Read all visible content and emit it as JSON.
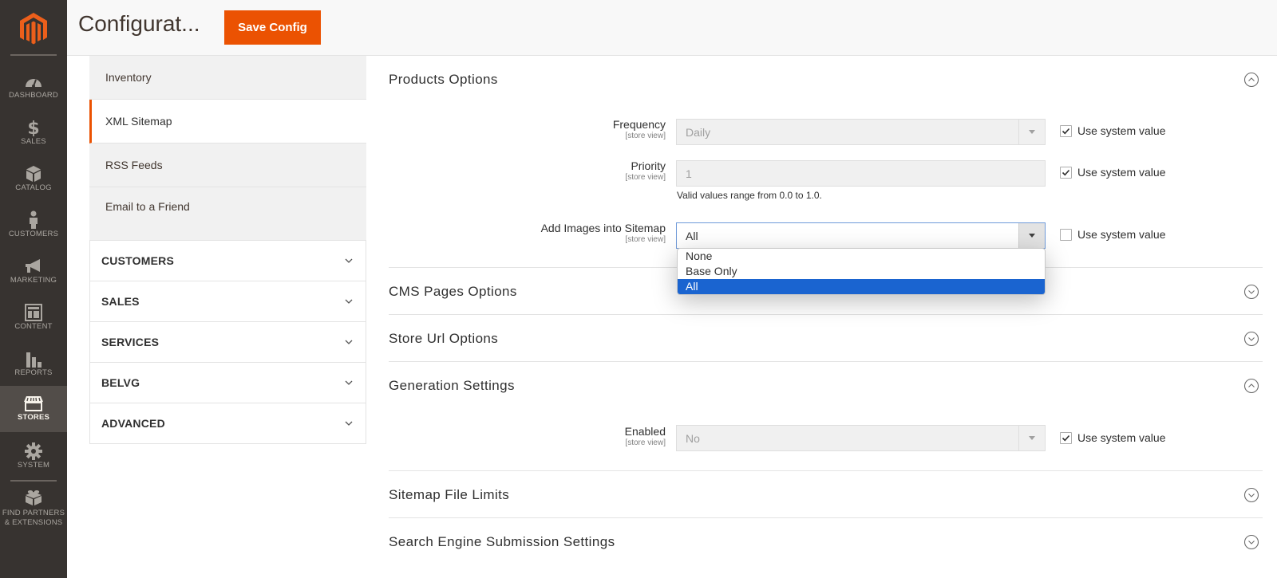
{
  "admin_nav": {
    "items": [
      {
        "label": "DASHBOARD",
        "icon": "dashboard-icon"
      },
      {
        "label": "SALES",
        "icon": "dollar-icon"
      },
      {
        "label": "CATALOG",
        "icon": "box-icon"
      },
      {
        "label": "CUSTOMERS",
        "icon": "person-icon"
      },
      {
        "label": "MARKETING",
        "icon": "megaphone-icon"
      },
      {
        "label": "CONTENT",
        "icon": "layout-icon"
      },
      {
        "label": "REPORTS",
        "icon": "bar-chart-icon"
      },
      {
        "label": "STORES",
        "icon": "storefront-icon",
        "active": true
      },
      {
        "label": "SYSTEM",
        "icon": "gear-icon"
      }
    ],
    "partners": {
      "line1": "FIND PARTNERS",
      "line2": "& EXTENSIONS",
      "icon": "lego-brick-icon"
    }
  },
  "header": {
    "title": "Configurat...",
    "save_label": "Save Config"
  },
  "config_tabs": {
    "sub_items": [
      {
        "label": "Inventory"
      },
      {
        "label": "XML Sitemap",
        "active": true
      },
      {
        "label": "RSS Feeds"
      },
      {
        "label": "Email to a Friend"
      }
    ],
    "groups": [
      {
        "label": "CUSTOMERS"
      },
      {
        "label": "SALES"
      },
      {
        "label": "SERVICES"
      },
      {
        "label": "BELVG"
      },
      {
        "label": "ADVANCED"
      }
    ]
  },
  "sections": {
    "products_options": {
      "title": "Products Options",
      "state": "expanded",
      "fields": {
        "frequency": {
          "label": "Frequency",
          "scope": "[store view]",
          "value": "Daily",
          "use_system_value": true
        },
        "priority": {
          "label": "Priority",
          "scope": "[store view]",
          "value": "1",
          "note": "Valid values range from 0.0 to 1.0.",
          "use_system_value": true
        },
        "add_images": {
          "label": "Add Images into Sitemap",
          "scope": "[store view]",
          "value": "All",
          "use_system_value": false,
          "options": [
            "None",
            "Base Only",
            "All"
          ],
          "selected_option": "All"
        }
      }
    },
    "cms_pages_options": {
      "title": "CMS Pages Options",
      "state": "collapsed"
    },
    "store_url_options": {
      "title": "Store Url Options",
      "state": "collapsed"
    },
    "generation_settings": {
      "title": "Generation Settings",
      "state": "expanded",
      "fields": {
        "enabled": {
          "label": "Enabled",
          "scope": "[store view]",
          "value": "No",
          "use_system_value": true
        }
      }
    },
    "sitemap_file_limits": {
      "title": "Sitemap File Limits",
      "state": "collapsed"
    },
    "search_engine_submission": {
      "title": "Search Engine Submission Settings",
      "state": "collapsed"
    }
  },
  "use_system_value_label": "Use system value",
  "colors": {
    "accent": "#eb5202",
    "nav_bg": "#373330",
    "nav_active_bg": "#524d49",
    "dropdown_selected": "#1a64d0"
  }
}
